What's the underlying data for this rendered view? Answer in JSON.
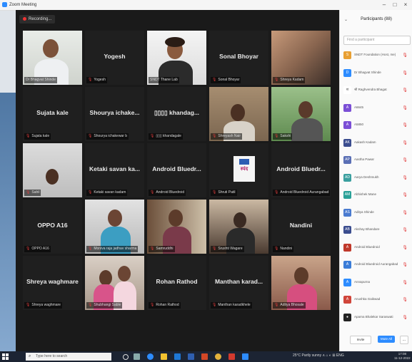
{
  "window": {
    "title": "Zoom Meeting",
    "min": "–",
    "max": "□",
    "close": "×"
  },
  "recording_label": "Recording...",
  "grid": [
    {
      "name": "",
      "label": "Dr Bhagvat Shinde",
      "muted": false,
      "video": "man-headset",
      "active": true
    },
    {
      "name": "Yogesh",
      "label": "Yogesh",
      "muted": true,
      "video": ""
    },
    {
      "name": "",
      "label": "SNDT Thane Lab",
      "muted": false,
      "video": "woman-glasses"
    },
    {
      "name": "Sonal Bhoyar",
      "label": "Sonal Bhoyar",
      "muted": true,
      "video": ""
    },
    {
      "name": "",
      "label": "Shreya Kadam",
      "muted": true,
      "video": "blur-room"
    },
    {
      "name": "Sujata kale",
      "label": "Sujata kale",
      "muted": true,
      "video": ""
    },
    {
      "name": "Shourya ichake...",
      "label": "Shourya ichakewar b",
      "muted": true,
      "video": ""
    },
    {
      "name": "▯▯▯▯ khandag...",
      "label": "▯▯▯ khandagale",
      "muted": true,
      "video": ""
    },
    {
      "name": "",
      "label": "Shreyash Nair",
      "muted": true,
      "video": "room-man"
    },
    {
      "name": "",
      "label": "Sakshi",
      "muted": true,
      "video": "outdoor-man"
    },
    {
      "name": "",
      "label": "Sahil",
      "muted": true,
      "video": "man-wall"
    },
    {
      "name": "Ketaki savan ka...",
      "label": "Ketaki savan kadam",
      "muted": true,
      "video": ""
    },
    {
      "name": "Android Bluedr...",
      "label": "Android Bluedroid",
      "muted": true,
      "video": ""
    },
    {
      "name": "",
      "label": "Shruti Patil",
      "muted": true,
      "video": "logo"
    },
    {
      "name": "Android Bluedr...",
      "label": "Android Bluedroid Aurangabad",
      "muted": true,
      "video": ""
    },
    {
      "name": "OPPO A16",
      "label": "OPPO A16",
      "muted": true,
      "video": ""
    },
    {
      "name": "",
      "label": "Moniva raja jadhav sharma",
      "muted": true,
      "video": "woman-blue"
    },
    {
      "name": "",
      "label": "Samruddhi",
      "muted": true,
      "video": "woman-door"
    },
    {
      "name": "",
      "label": "Srushti Wagare",
      "muted": true,
      "video": "woman-dark"
    },
    {
      "name": "Nandini",
      "label": "Nandini",
      "muted": true,
      "video": ""
    },
    {
      "name": "Shreya waghmare",
      "label": "Shreya waghmare",
      "muted": true,
      "video": ""
    },
    {
      "name": "",
      "label": "Shubhangi Sable",
      "muted": true,
      "video": "two-women"
    },
    {
      "name": "Rohan Rathod",
      "label": "Rohan Rathod",
      "muted": true,
      "video": ""
    },
    {
      "name": "Manthan karad...",
      "label": "Manthan karadkhele",
      "muted": true,
      "video": ""
    },
    {
      "name": "",
      "label": "Aditya Bhosale",
      "muted": true,
      "video": "woman-pink"
    }
  ],
  "panel": {
    "title": "Participants (88)",
    "search_placeholder": "Find a participant",
    "participants": [
      {
        "initials": "S",
        "name": "SNDT Foundation (Host, me)",
        "color": "#e8a033"
      },
      {
        "initials": "D",
        "name": "Dr Bhagvat Shinde",
        "color": "#2d8cff"
      },
      {
        "initials": "श",
        "name": "श्री Raghvendra Bhagat",
        "color": "#ffffff"
      },
      {
        "initials": "A",
        "name": "A6645",
        "color": "#7b4fd6"
      },
      {
        "initials": "A",
        "name": "A5850",
        "color": "#7b4fd6"
      },
      {
        "initials": "AK",
        "name": "Aakash Kadam",
        "color": "#3b4d8f"
      },
      {
        "initials": "AP",
        "name": "Aastha Pawar",
        "color": "#5a6fb5"
      },
      {
        "initials": "AD",
        "name": "Aarya Deshmukh",
        "color": "#3a9f9f"
      },
      {
        "initials": "AM",
        "name": "Abhishek Mane",
        "color": "#2aa198"
      },
      {
        "initials": "AS",
        "name": "Aditya Shinde",
        "color": "#4a7bd0"
      },
      {
        "initials": "AB",
        "name": "Akshay Bhandare",
        "color": "#3b4d8f"
      },
      {
        "initials": "A",
        "name": "Android Bluedroid",
        "color": "#c0392b"
      },
      {
        "initials": "A",
        "name": "Android Bluedroid Aurangabad",
        "color": "#3b7dd8"
      },
      {
        "initials": "A",
        "name": "Annapurna",
        "color": "#2d8cff"
      },
      {
        "initials": "A",
        "name": "Anushka Gaikwad",
        "color": "#d0453a"
      },
      {
        "initials": "●",
        "name": "Aparna Bhalekar Saraswati",
        "color": "#222222"
      }
    ],
    "invite": "Invite",
    "mute_all": "Mute All",
    "more": "..."
  },
  "taskbar": {
    "search_placeholder": "Type here to search",
    "tray_text": "25°C Partly sunny  ∧  ⌂  ◐  ⊞  ENG",
    "time": "17:08",
    "date": "11-12-2022"
  },
  "colors": {
    "accent": "#2d8cff",
    "muted": "#e23c3c",
    "active_outline": "#d6d42c"
  }
}
